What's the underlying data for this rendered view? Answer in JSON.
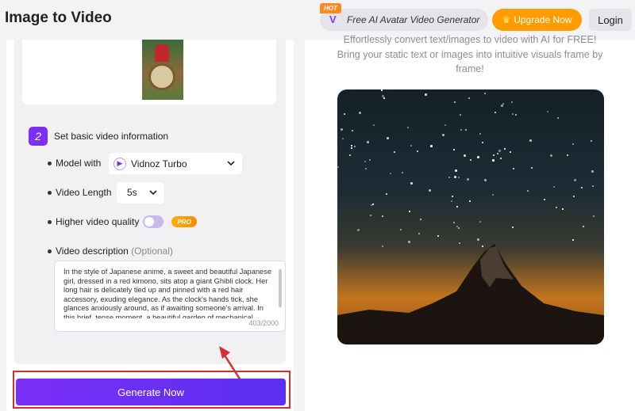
{
  "header": {
    "title": "Image to Video",
    "promo_badge": "HOT",
    "promo_text": "Free AI Avatar Video Generator",
    "upgrade_label": "Upgrade Now",
    "login_label": "Login"
  },
  "step2": {
    "number": "2",
    "title": "Set basic video information",
    "model_label": "Model with",
    "model_value": "Vidnoz Turbo",
    "length_label": "Video Length",
    "length_value": "5s",
    "quality_label": "Higher video quality",
    "quality_on": false,
    "pro_badge": "PRO",
    "description_label": "Video description",
    "description_optional": "(Optional)",
    "description_text": "In the style of Japanese anime, a sweet and beautiful Japanese girl, dressed in a red kimono, sits atop a giant Ghibli clock. Her long hair is delicately tied up and pinned with a red hair accessory, exuding elegance. As the clock's hands tick, she glances anxiously around, as if awaiting someone's arrival. In this brief, tense moment, a beautiful garden of mechanical plants",
    "char_count": "403/2000"
  },
  "generate_label": "Generate Now",
  "right": {
    "line1": "Effortlessly convert text/images to video with AI for FREE!",
    "line2": "Bring your static text or images into intuitive visuals frame by",
    "line3": "frame!"
  },
  "colors": {
    "accent": "#7b2ff7",
    "upgrade": "#ff9d00",
    "highlight": "#d32f2f"
  }
}
